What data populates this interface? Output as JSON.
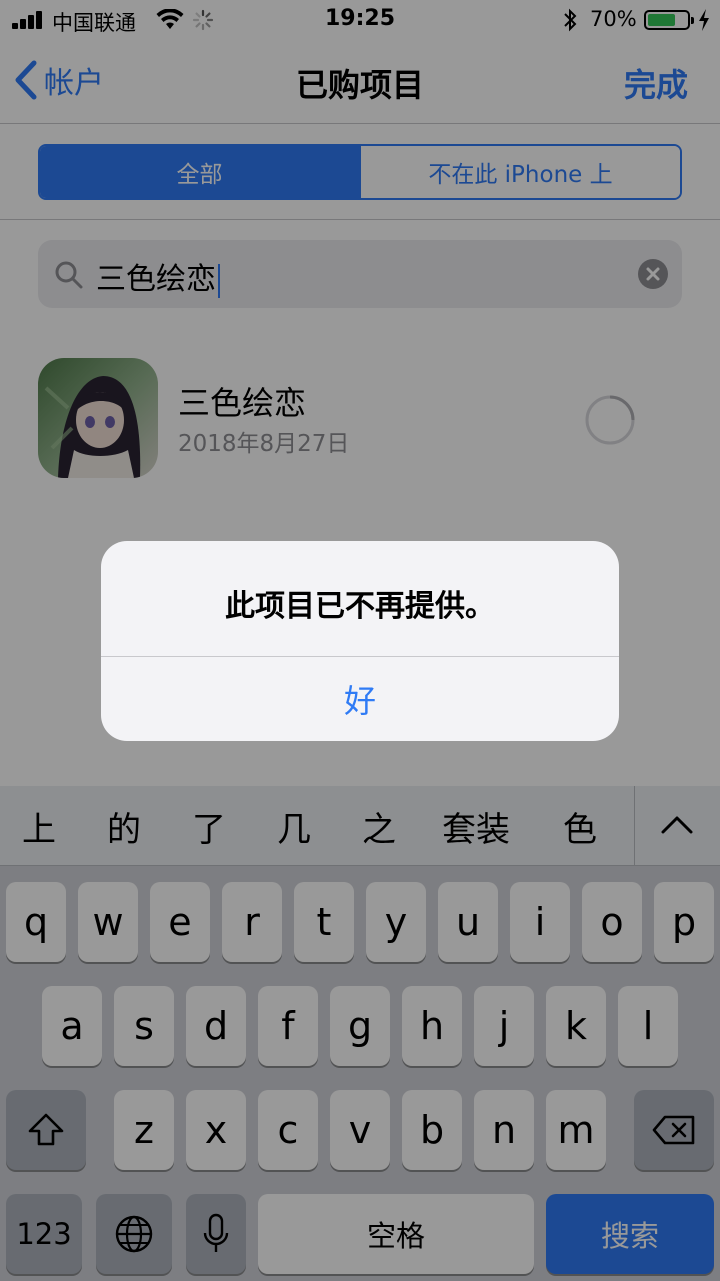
{
  "status_bar": {
    "carrier": "中国联通",
    "time": "19:25",
    "battery_percent": "70%",
    "battery_level": 0.7
  },
  "nav": {
    "back_label": "帐户",
    "title": "已购项目",
    "done_label": "完成"
  },
  "segments": {
    "all": "全部",
    "not_on_device": "不在此 iPhone 上",
    "selected": "all"
  },
  "search": {
    "value": "三色绘恋"
  },
  "results": [
    {
      "name": "三色绘恋",
      "date": "2018年8月27日"
    }
  ],
  "alert": {
    "message": "此项目已不再提供。",
    "ok_label": "好"
  },
  "suggestions": [
    "上",
    "的",
    "了",
    "几",
    "之",
    "套装",
    "色"
  ],
  "keyboard": {
    "row1": [
      "q",
      "w",
      "e",
      "r",
      "t",
      "y",
      "u",
      "i",
      "o",
      "p"
    ],
    "row2": [
      "a",
      "s",
      "d",
      "f",
      "g",
      "h",
      "j",
      "k",
      "l"
    ],
    "row3": [
      "z",
      "x",
      "c",
      "v",
      "b",
      "n",
      "m"
    ],
    "numbers_label": "123",
    "space_label": "空格",
    "search_label": "搜索"
  },
  "colors": {
    "accent": "#2f7bf5",
    "battery_green": "#34c759",
    "overlay": "rgba(0,0,0,0.40)"
  }
}
